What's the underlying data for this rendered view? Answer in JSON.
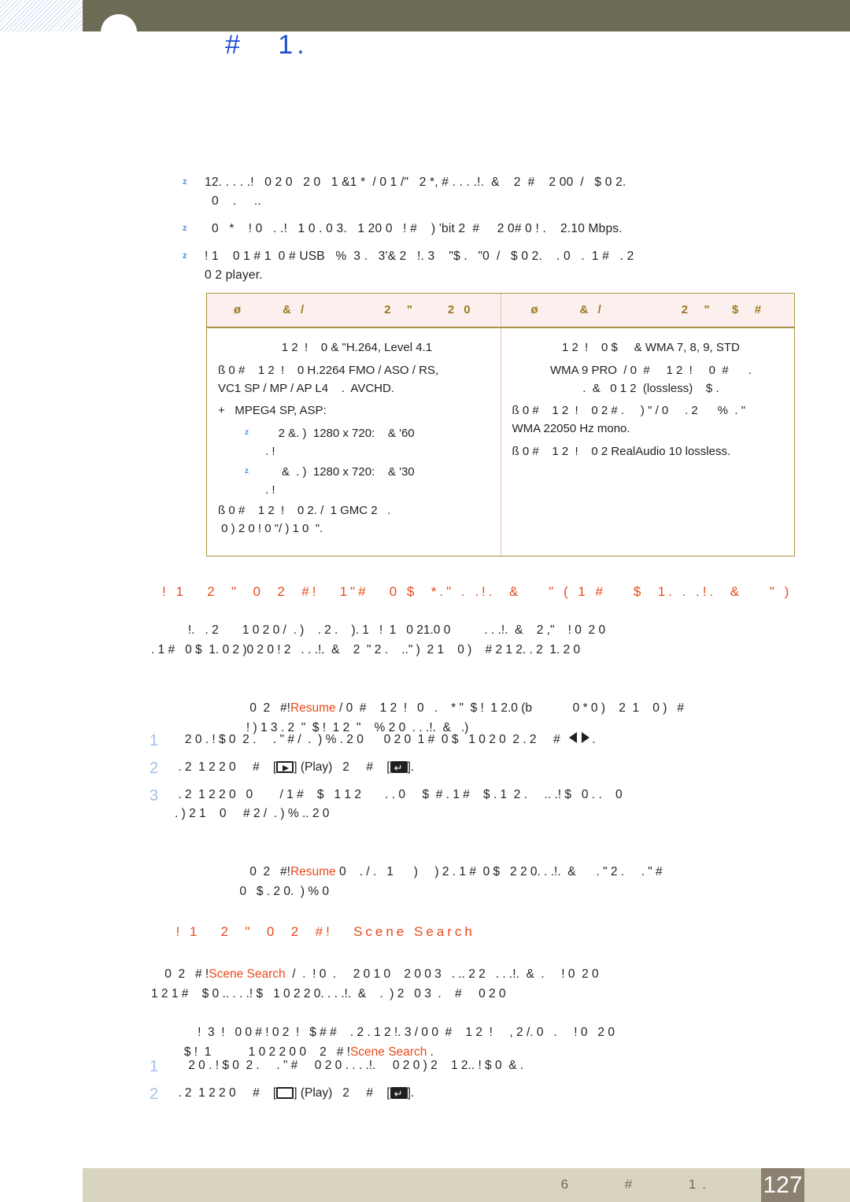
{
  "header": {
    "chapter_title": "#   1.",
    "hatch_icon": "diagonal-hatch-pattern",
    "circle_icon": "chapter-circle-badge"
  },
  "bullets": [
    {
      "marker": "z",
      "text": "12. . . . .!   0 2 0   2 0   1 &1 *  / 0 1 /\"   2 *, # . . . .!.  &    2  #    2 00  /   $ 0 2.\n  0    .     .."
    },
    {
      "marker": "z",
      "text": "  0   *    ! 0   . .!   1 0 . 0 3.   1 20 0   ! #    ) 'bit 2  #     2 0# 0 ! .    2.10 Mbps."
    },
    {
      "marker": "z",
      "text": "! 1    0 1 # 1  0 # USB   %  3 .   3'& 2   !. 3    \"$ .   \"0  /   $ 0 2.    . 0   .  1 #   . 2\n0 2 player."
    }
  ],
  "spec_table": {
    "headers": [
      "ø      & /            2  \"     2 0",
      "ø      & /            2  \"   $  #"
    ],
    "video_column": {
      "lines": [
        "  1 2  !    0 & \"H.264, Level 4.1",
        "ß 0 #    1 2  !    0 H.2264 FMO / ASO / RS,\nVC1 SP / MP / AP L4    .  AVCHD.",
        "+   MPEG4 SP, ASP:"
      ],
      "sub_bullets": [
        {
          "marker": "z",
          "text": "    2 &. )  1280 x 720:    & '60\n. !"
        },
        {
          "marker": "z",
          "text": "     &  . )  1280 x 720:    & '30\n. !"
        }
      ],
      "footer_line": "ß 0 #    1 2  !    0 2. /  1 GMC 2   .\n 0 ) 2 0 ! 0 \"/ ) 1 0  \"."
    },
    "audio_column": {
      "lines": [
        "  1 2  !    0 $     & WMA 7, 8, 9, STD",
        "  WMA 9 PRO  / 0  #     1 2  !     0  #      .\n  .  &   0 1 2  (lossless)    $ .",
        "ß 0 #    1 2  !    0 2 # .     ) \" / 0     . 2      %  . \"\nWMA 22050 Hz mono.",
        "ß 0 #    1 2  !    0 2 RealAudio 10 lossless."
      ]
    }
  },
  "section_resume": {
    "heading": "! 1   2  \"  0  2  #!   1\"#   0 $  *.\" . .!.  &    \" ( 1 #    $  1. . .!.  &    \" )",
    "paragraph": "   !.   . 2       1 0 2 0 /  . )    . 2 .    ). 1   !  1   0 21.0 0          . . .!.  &    2 ,\"    ! 0  2 0\n. 1 #   0 $  1. 0 2 )0 2 0 ! 2   . . .!.  &    2  \" 2 .    ..\" )  2 1    0 )    # 2 1 2. . 2  1. 2 0",
    "note_prefix": "  0  2   #!",
    "note_accent": "Resume",
    "note_suffix": " / 0  #    1 2  !   0   .    * \"  $ !  1 2.0 (b            0 * 0 )    2  1    0 )   #\n   ! ) 1 3 . 2  \"  $ !  1 2  \"    % 2 0  . . .!.  &   .)",
    "steps": [
      {
        "num": "1",
        "text_before": "   2 0 . ! $ 0  2 .     . \" # /  .  ) % . 2 0      0 2 0  1 #  0 $   1 0 2 0  2 . 2     #  ",
        "glyphs": [
          "arrow-left",
          "arrow-right"
        ],
        "text_after": "."
      },
      {
        "num": "2",
        "text_before": " . 2  1 2 2 0     #    [",
        "key1": "play-key",
        "mid": "] (Play)   2     #    [",
        "key2": "enter-key",
        "text_after": "]."
      },
      {
        "num": "3",
        "text": " . 2  1 2 2 0   0        / 1 #    $   1 1 2       . . 0     $  # . 1 #    $ . 1  2 .     .. .! $   0 . .    0\n. ) 2 1    0     # 2 /  . ) % .. 2 0"
      }
    ],
    "step3_note_prefix": "  0  2   #!",
    "step3_note_accent": "Resume",
    "step3_note_suffix": " 0    . / .   1      )     ) 2 . 1 #  0 $   2 2 0. . .!.  &      . \" 2 .     . \" #\n 0   $ . 2 0.  ) % 0"
  },
  "section_scene": {
    "heading_prefix": "! 1   2  \"  0  2  #!   ",
    "heading_accent": "Scene Search",
    "paragraph_prefix": "  0  2   # !",
    "paragraph_accent": "Scene Search",
    "paragraph_suffix": "  /  .  ! 0  .     2 0 1 0    2 0 0 3   . .. 2 2   . . .!.  &  .     ! 0  2 0\n1 2 1 #    $ 0 .. . . .! $   1 0 2 2 0. . . .!.  &    .  ) 2   0 3  .    #     0 2 0",
    "note_line1": "        !  3  !   0 0 # ! 0 2  !   $ # #    . 2 . 1 2 !. 3 / 0 0  #    1 2  !     , 2 /. 0   .     ! 0   2 0",
    "note_line2_prefix": "    $ !  1           1 0 2 2 0 0    2   # !",
    "note_line2_accent": "Scene Search",
    "note_line2_suffix": " .",
    "steps": [
      {
        "num": "1",
        "text": "    2 0 . ! $ 0  2 .     . \" #     0 2 0 . . . .!.     0 2 0 ) 2    1 2.. ! $ 0  & ."
      },
      {
        "num": "2",
        "text_before": " . 2  1 2 2 0     #    [",
        "key1": "box-key",
        "mid": "] (Play)   2     #    [",
        "key2": "enter-key",
        "text_after": "]."
      }
    ]
  },
  "footer": {
    "text": "6     #     1.",
    "page_number": "127"
  },
  "colors": {
    "header_olive": "#6b6b56",
    "title_blue": "#1b4fd1",
    "accent_orange": "#e8491b",
    "table_border": "#a89444",
    "table_head_bg": "#fcf0ef",
    "table_head_text": "#9c7a1e",
    "step_number_blue": "#9fc0ea",
    "bullet_blue": "#4a90e2",
    "footer_bg": "#d8d4c0",
    "footer_page_bg": "#8c8071"
  }
}
